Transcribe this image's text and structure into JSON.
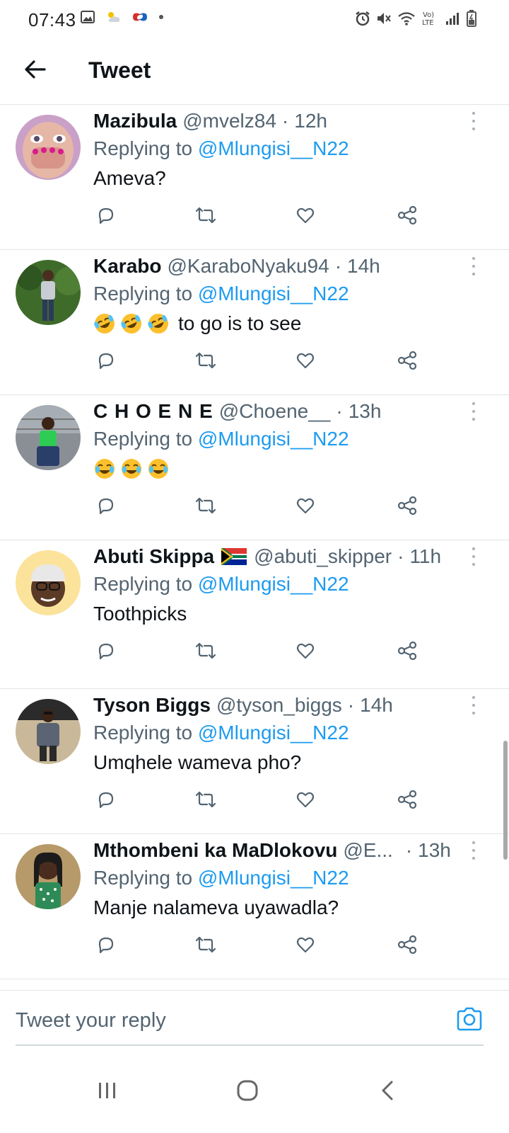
{
  "status_bar": {
    "time": "07:43",
    "left_icons": [
      "gallery-icon",
      "weather-icon",
      "app-notification-icon",
      "dot-icon"
    ],
    "right_icons": [
      "alarm-icon",
      "mute-icon",
      "wifi-icon",
      "volte-icon",
      "signal-icon",
      "battery-icon"
    ]
  },
  "header": {
    "title": "Tweet",
    "back_icon": "arrow-left-icon"
  },
  "tweets": [
    {
      "name": "Mazibula",
      "handle": "@mvelz84",
      "separator": "·",
      "time": "12h",
      "replying_prefix": "Replying to",
      "replying_to": "@Mlungisi__N22",
      "text": "Ameva?"
    },
    {
      "name": "Karabo",
      "handle": "@KaraboNyaku94",
      "separator": "·",
      "time": "14h",
      "replying_prefix": "Replying to",
      "replying_to": "@Mlungisi__N22",
      "text": "to go is to see",
      "emojis": [
        "rolling-laughing-emoji",
        "rolling-laughing-emoji",
        "rolling-laughing-emoji"
      ]
    },
    {
      "name": "C H O E N E",
      "handle": "@Choene__",
      "separator": "·",
      "time": "13h",
      "replying_prefix": "Replying to",
      "replying_to": "@Mlungisi__N22",
      "text": "",
      "emojis": [
        "tears-of-joy-emoji",
        "tears-of-joy-emoji",
        "tears-of-joy-emoji"
      ]
    },
    {
      "name": "Abuti Skippa",
      "name_flag": "south-africa-flag",
      "handle": "@abuti_skipper",
      "separator": "·",
      "time": "11h",
      "replying_prefix": "Replying to",
      "replying_to": "@Mlungisi__N22",
      "text": "Toothpicks"
    },
    {
      "name": "Tyson Biggs",
      "handle": "@tyson_biggs",
      "separator": "·",
      "time": "14h",
      "replying_prefix": "Replying to",
      "replying_to": "@Mlungisi__N22",
      "text": "Umqhele wameva pho?"
    },
    {
      "name": "Mthombeni ka MaDlokovu",
      "handle": "@E...",
      "separator": "·",
      "time": "13h",
      "replying_prefix": "Replying to",
      "replying_to": "@Mlungisi__N22",
      "text": "Manje nalameva uyawadla?"
    }
  ],
  "tweet_actions": [
    "reply-icon",
    "retweet-icon",
    "like-icon",
    "share-icon"
  ],
  "reply_bar": {
    "placeholder": "Tweet your reply",
    "camera_icon": "camera-icon"
  },
  "nav_bar": {
    "buttons": [
      "recent-apps-icon",
      "home-icon",
      "back-icon"
    ]
  },
  "colors": {
    "link": "#1d9bf0",
    "secondary_text": "#536471",
    "divider": "#e1e6ea",
    "icon_gray": "#536471"
  }
}
